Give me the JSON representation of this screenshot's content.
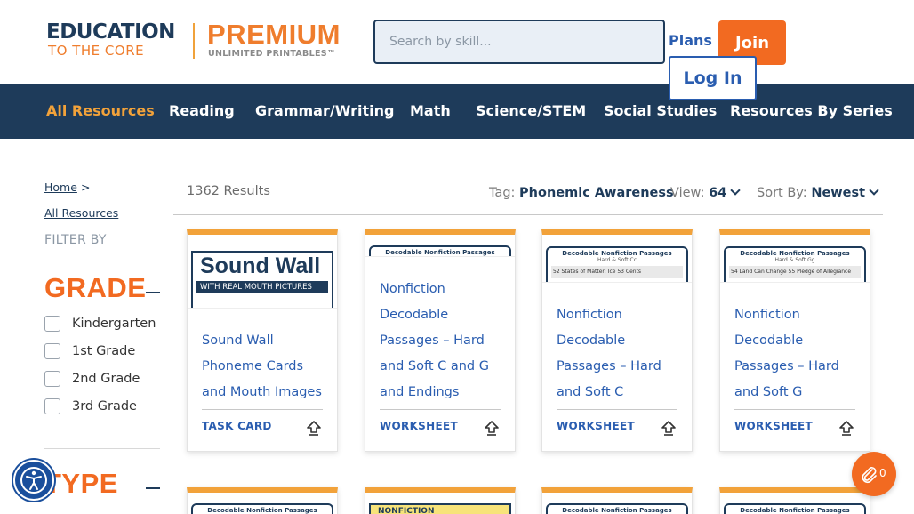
{
  "brand": {
    "line1": "EDUCATION",
    "line2": "TO THE CORE",
    "premium": "PREMIUM",
    "tagline": "UNLIMITED PRINTABLES™"
  },
  "search": {
    "placeholder": "Search by skill..."
  },
  "header": {
    "plans": "Plans",
    "join": "Join",
    "login": "Log In"
  },
  "nav": {
    "items": [
      "All Resources",
      "Reading",
      "Grammar/Writing",
      "Math",
      "Science/STEM",
      "Social Studies",
      "Resources By Series"
    ]
  },
  "breadcrumb": {
    "home": "Home",
    "separator": ">",
    "current": "All Resources"
  },
  "filters": {
    "heading": "FILTER BY",
    "grade": {
      "title": "GRADE",
      "options": [
        "Kindergarten",
        "1st Grade",
        "2nd Grade",
        "3rd Grade"
      ]
    },
    "type": {
      "title": "TYPE"
    }
  },
  "results": {
    "count": "1362 Results",
    "tag_label": "Tag:",
    "tag_value": "Phonemic Awareness",
    "view_label": "View:",
    "view_value": "64",
    "sort_label": "Sort By:",
    "sort_value": "Newest"
  },
  "cards": [
    {
      "title_lines": [
        "Sound Wall",
        "Phoneme Cards",
        "and Mouth Images"
      ],
      "type": "TASK CARD",
      "thumb_main": "Sound Wall",
      "thumb_sub": "WITH REAL MOUTH PICTURES"
    },
    {
      "title_lines": [
        "Nonfiction",
        "Decodable",
        "Passages – Hard",
        "and Soft C and G",
        "and Endings"
      ],
      "type": "WORKSHEET",
      "thumb_head": "Decodable Nonfiction Passages"
    },
    {
      "title_lines": [
        "Nonfiction",
        "Decodable",
        "Passages – Hard",
        "and Soft C"
      ],
      "type": "WORKSHEET",
      "thumb_head": "Decodable Nonfiction Passages",
      "thumb_sub1": "Hard & Soft Cc",
      "thumb_row": "52 States of Matter: Ice   53 Cents"
    },
    {
      "title_lines": [
        "Nonfiction",
        "Decodable",
        "Passages – Hard",
        "and Soft G"
      ],
      "type": "WORKSHEET",
      "thumb_head": "Decodable Nonfiction Passages",
      "thumb_sub1": "Hard & Soft Gg",
      "thumb_row": "54 Land Can Change   55 Pledge of Allegiance"
    }
  ],
  "row2_thumbs": [
    "Decodable Nonfiction Passages",
    "NONFICTION",
    "Decodable Nonfiction Passages",
    "Decodable Nonfiction Passages"
  ],
  "cart": {
    "count": "0"
  },
  "colors": {
    "navy": "#1e3b5a",
    "orange": "#f26a21",
    "gold": "#f2a23a",
    "link": "#2a5db0"
  },
  "icons": [
    "paperclip-icon",
    "accessibility-icon",
    "share-icon",
    "chevron-down-icon"
  ]
}
